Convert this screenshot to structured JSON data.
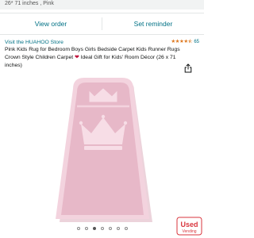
{
  "variant_text": "26* 71 inches , Pink",
  "actions": {
    "view_order": "View order",
    "set_reminder": "Set reminder"
  },
  "store": {
    "link_text": "Visit the HUAHOO Store"
  },
  "rating": {
    "stars": 4.5,
    "stars_glyphs": "★★★★⯪",
    "count": "65"
  },
  "product": {
    "title_part1": "Pink Kids Rug for Bedroom Boys Girls Bedside Carpet Kids Runner Rugs Crown Style Children Carpet",
    "title_part2": "Ideal Gift for Kids' Room Décor (26 x 71 inches)",
    "heart_glyph": "❤"
  },
  "image_dots": {
    "total": 7,
    "active_index": 2
  },
  "watermark": {
    "text": "Used",
    "subtext": "Vending"
  },
  "colors": {
    "link": "#007185",
    "star": "#de7921",
    "rug_base": "#e7b8c8",
    "rug_border": "#f3d3de",
    "watermark": "#d9363e"
  },
  "icons": {
    "share": "share-icon",
    "crown": "crown-icon"
  }
}
